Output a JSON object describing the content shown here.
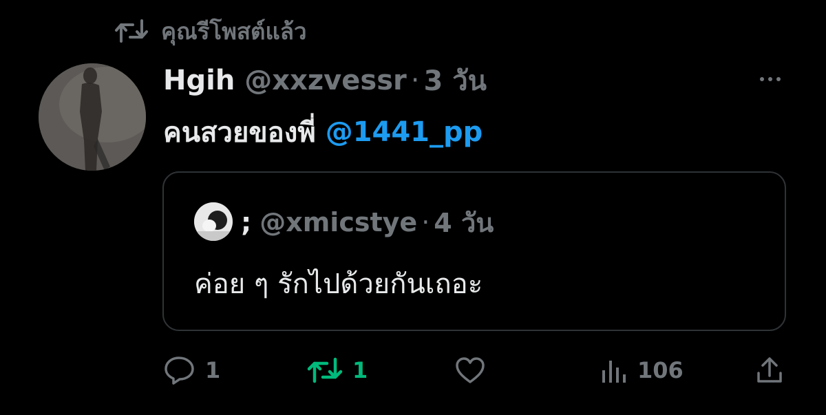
{
  "repost": {
    "label": "คุณรีโพสต์แล้ว",
    "icon": "repost-icon"
  },
  "post": {
    "author_name": "Hgih",
    "handle": "@xxzvessr",
    "separator": "·",
    "time": "3 วัน",
    "text": "คนสวยของพี่",
    "mention": "@1441_pp"
  },
  "quote": {
    "author_name": ";",
    "handle": "@xmicstye",
    "separator": "·",
    "time": "4 วัน",
    "text": "ค่อย ๆ รักไปด้วยกันเถอะ"
  },
  "actions": {
    "reply_count": "1",
    "repost_count": "1",
    "views_count": "106"
  },
  "colors": {
    "background": "#000000",
    "primary_text": "#e7e9ea",
    "secondary_text": "#71767b",
    "link": "#1d9bf0",
    "repost_active": "#00ba7c",
    "border": "#2f3336"
  }
}
